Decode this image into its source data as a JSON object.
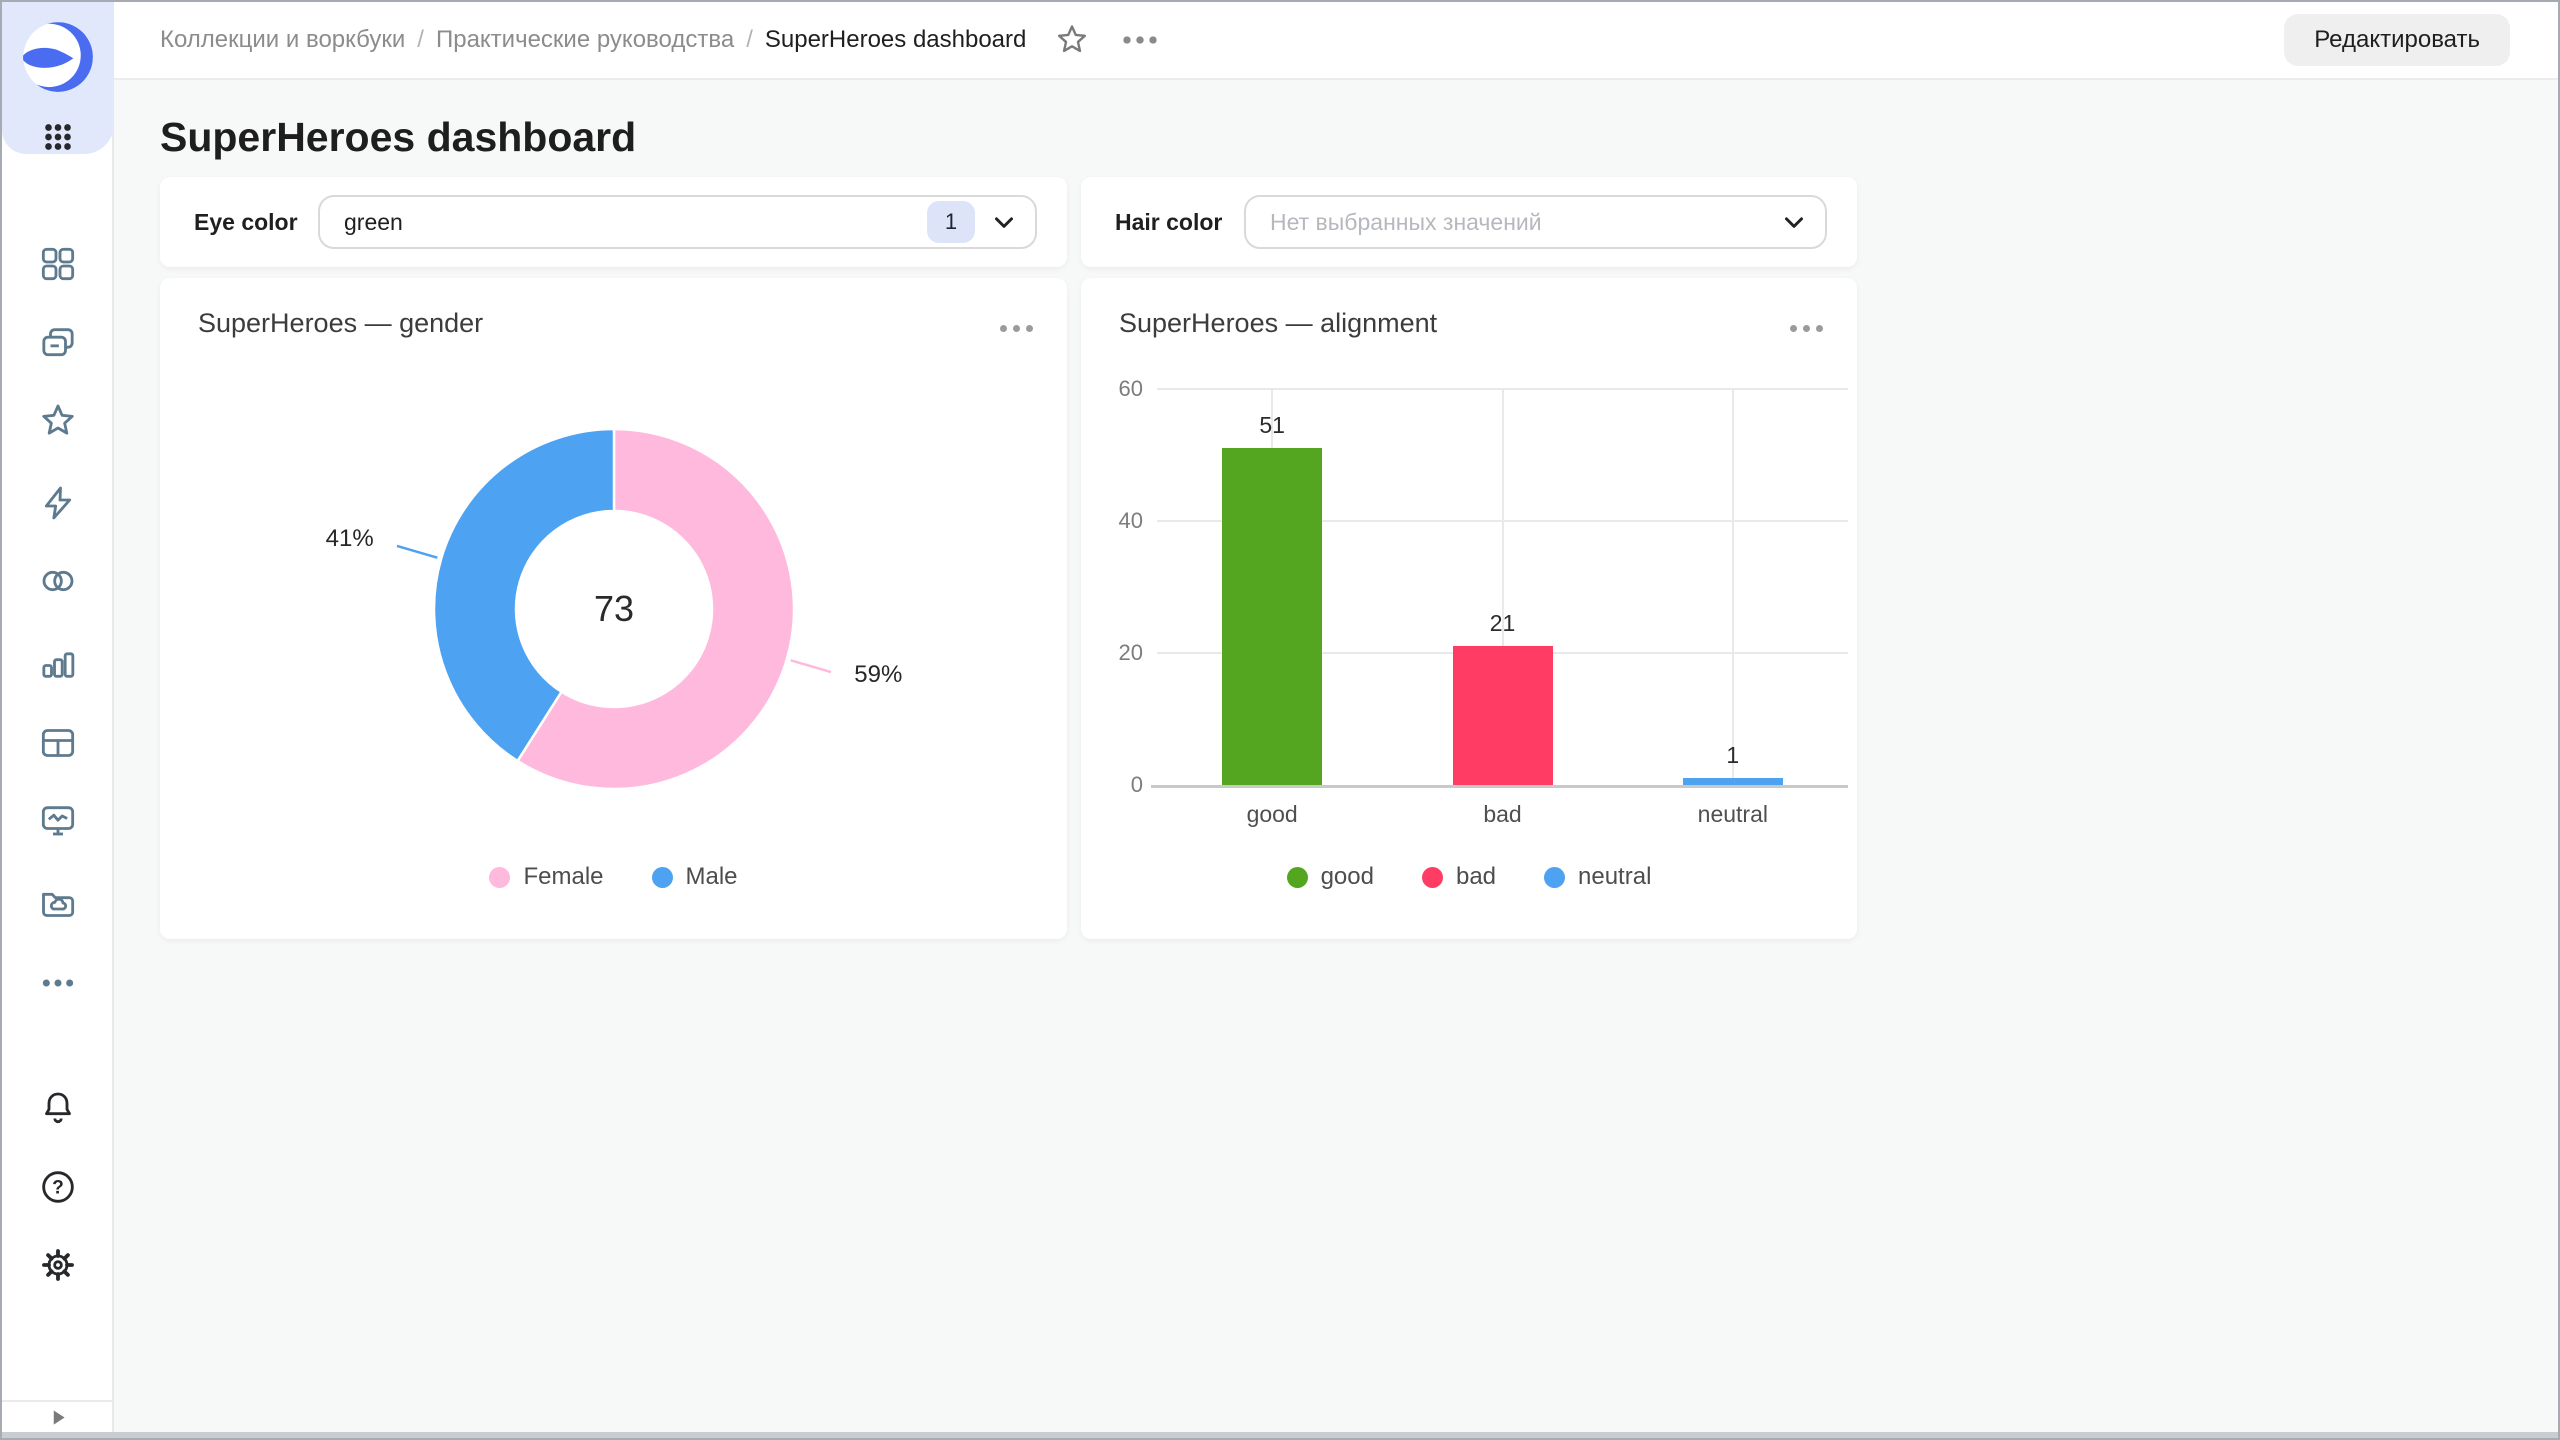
{
  "window": {
    "edit_button": "Редактировать"
  },
  "breadcrumbs": {
    "items": [
      "Коллекции и воркбуки",
      "Практические руководства",
      "SuperHeroes dashboard"
    ],
    "separator": "/"
  },
  "page_title": "SuperHeroes dashboard",
  "filters": [
    {
      "label": "Eye color",
      "value": "green",
      "badge_count": "1"
    },
    {
      "label": "Hair color",
      "placeholder": "Нет выбранных значений"
    }
  ],
  "sidebar": {
    "icons": [
      "datalens-logo",
      "apps-grid",
      "tiles",
      "stacked-folders",
      "star",
      "lightning",
      "overlapping-circles",
      "bar-chart",
      "table",
      "monitor-pulse",
      "folder-cloud",
      "ellipsis",
      "bell",
      "question-circle",
      "gear",
      "play-triangle"
    ]
  },
  "header_icons": [
    "star-outline",
    "ellipsis"
  ],
  "colors": {
    "accent_blue": "#4a6cf0",
    "sidebar_icon": "#5e7a8e",
    "badge_bg": "#dde4fa",
    "card_bg": "#ffffff",
    "page_bg": "#f7f8f8"
  },
  "chart_data": [
    {
      "type": "pie",
      "subtype": "donut",
      "title": "SuperHeroes — gender",
      "total_label": "73",
      "series": [
        {
          "name": "Female",
          "value": 59,
          "percent_label": "59%",
          "color": "#FFB9DD"
        },
        {
          "name": "Male",
          "value": 41,
          "percent_label": "41%",
          "color": "#4DA2F1"
        }
      ],
      "legend": [
        "Female",
        "Male"
      ],
      "legend_position": "bottom"
    },
    {
      "type": "bar",
      "title": "SuperHeroes — alignment",
      "categories": [
        "good",
        "bad",
        "neutral"
      ],
      "values": [
        51,
        21,
        1
      ],
      "colors": [
        "#54A520",
        "#FF3D64",
        "#4DA2F1"
      ],
      "ylim": [
        0,
        60
      ],
      "yticks": [
        0,
        20,
        40,
        60
      ],
      "grid": true,
      "legend": [
        "good",
        "bad",
        "neutral"
      ],
      "legend_position": "bottom"
    }
  ]
}
